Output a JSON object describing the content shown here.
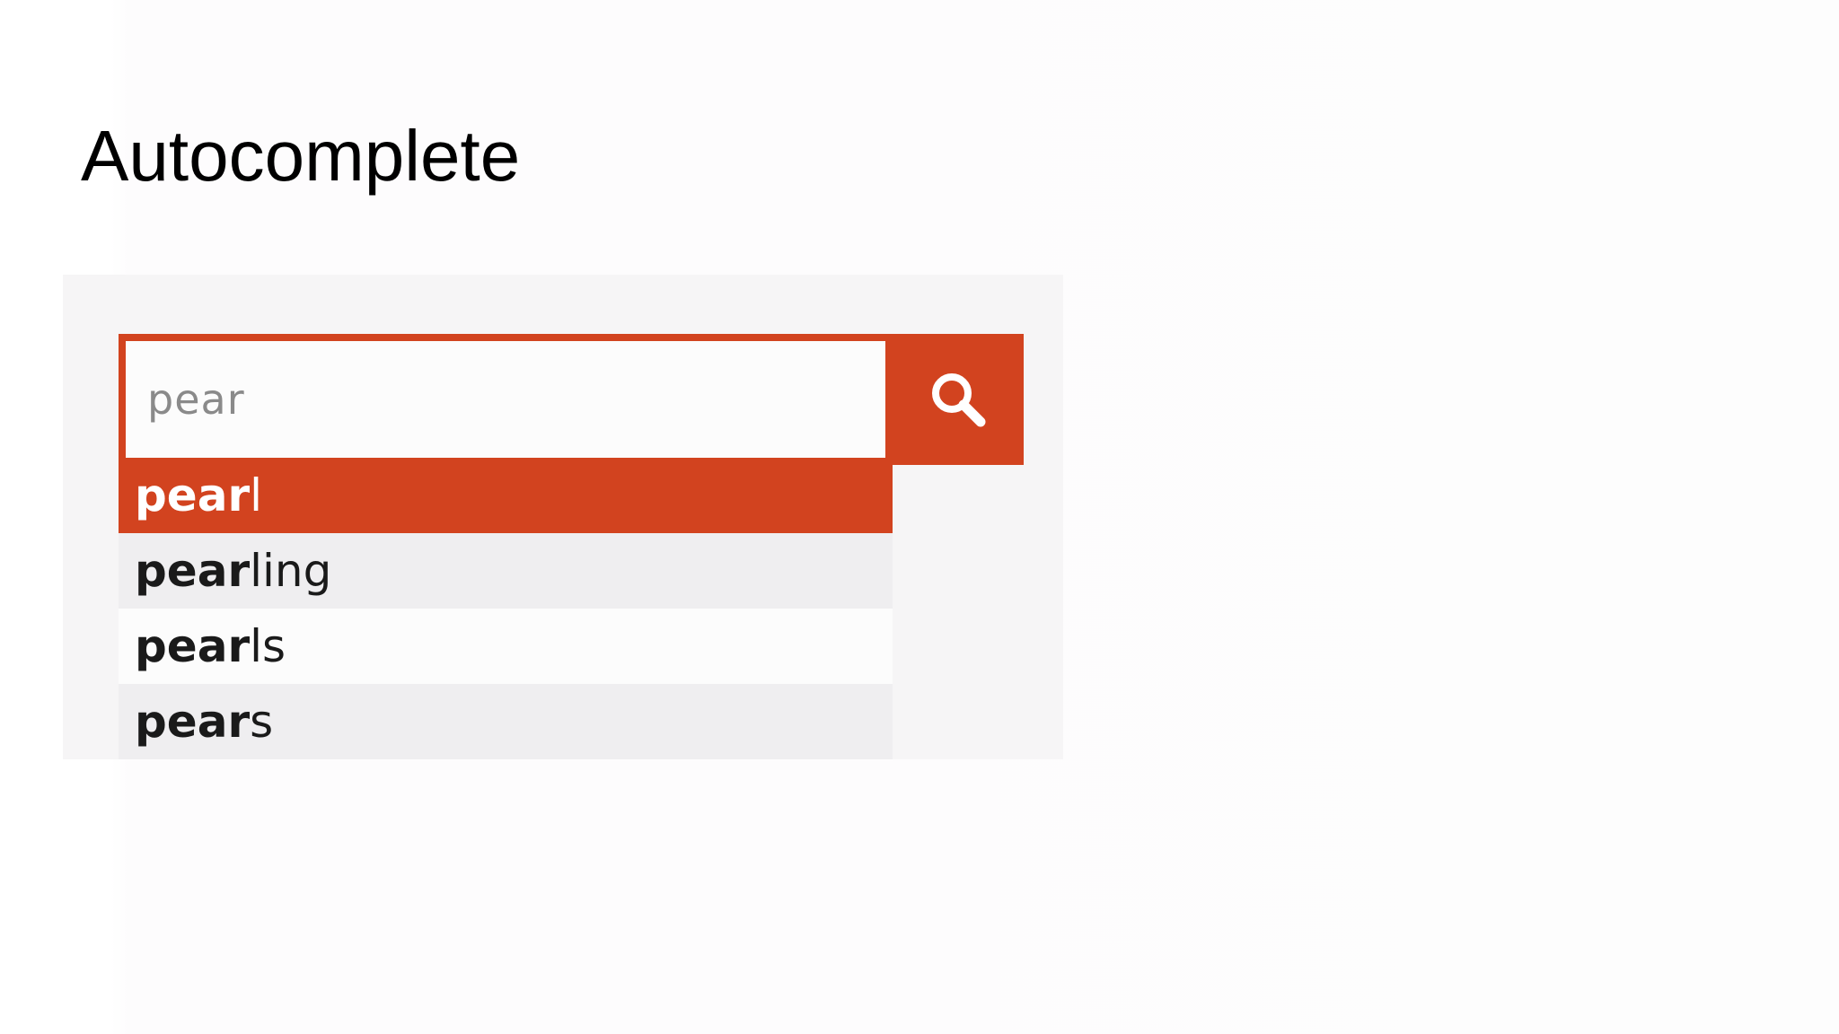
{
  "slide": {
    "title": "Autocomplete"
  },
  "search": {
    "query": "pear",
    "button_icon": "search-icon"
  },
  "suggestions": [
    {
      "match": "pear",
      "rest": "l",
      "state": "active"
    },
    {
      "match": "pear",
      "rest": "ling",
      "state": "alt"
    },
    {
      "match": "pear",
      "rest": "ls",
      "state": "plain"
    },
    {
      "match": "pear",
      "rest": "s",
      "state": "alt"
    }
  ],
  "colors": {
    "accent": "#d2431f",
    "active_text": "#ffffff",
    "row_alt": "#efeef0",
    "row_plain": "#fcfcfc",
    "panel": "#f6f5f6",
    "input_text": "#8a8a8a"
  }
}
